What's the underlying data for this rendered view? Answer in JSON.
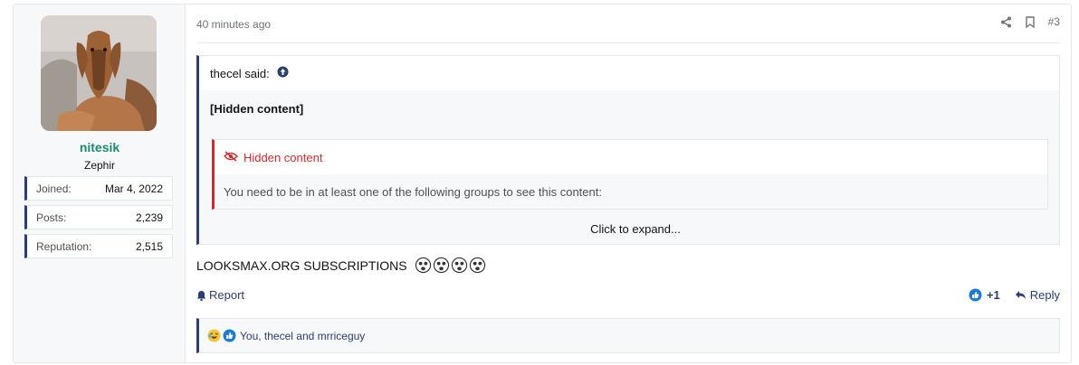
{
  "user": {
    "name": "nitesik",
    "title": "Zephir",
    "avatar_icon": "dog-avatar-icon",
    "stats": [
      {
        "label": "Joined:",
        "value": "Mar 4, 2022"
      },
      {
        "label": "Posts:",
        "value": "2,239"
      },
      {
        "label": "Reputation:",
        "value": "2,515"
      }
    ]
  },
  "post": {
    "timestamp": "40 minutes ago",
    "number": "#3",
    "quote": {
      "author_said": "thecel said:",
      "body": "[Hidden content]",
      "hidden": {
        "title": "Hidden content",
        "message": "You need to be in at least one of the following groups to see this content:"
      },
      "expand_label": "Click to expand..."
    },
    "text": "LOOKSMAX.ORG SUBSCRIPTIONS",
    "actions": {
      "report_label": "Report",
      "reaction_count": "+1",
      "reply_label": "Reply"
    },
    "reactions_summary": "You, thecel and mrriceguy"
  },
  "colors": {
    "accent": "#2b3e6f",
    "username": "#1b8b6e",
    "hidden": "#cf2d2d"
  }
}
